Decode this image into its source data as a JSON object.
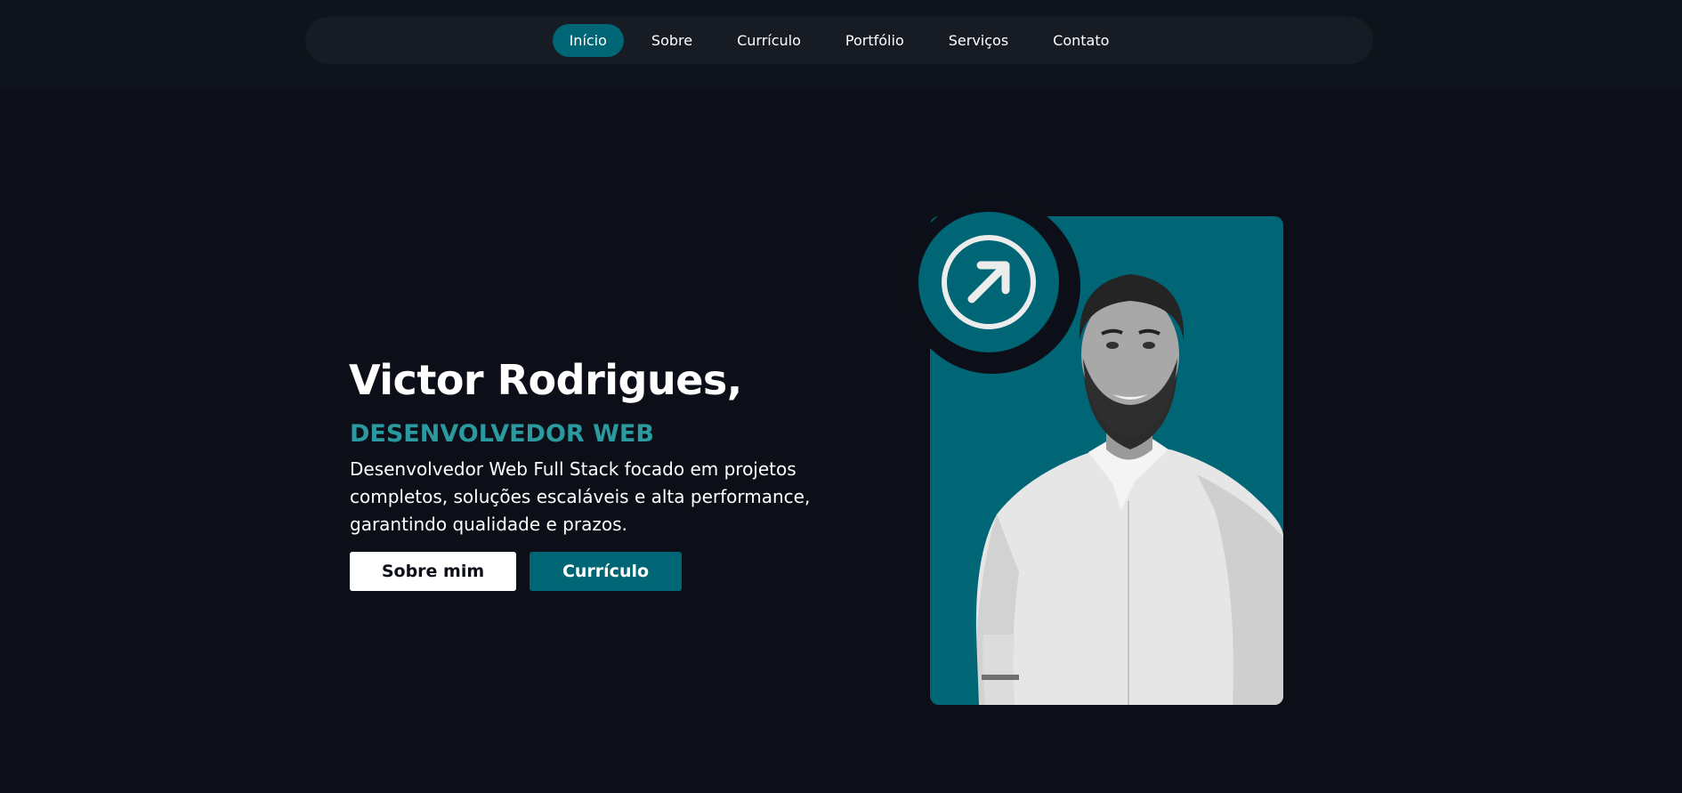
{
  "nav": {
    "items": [
      {
        "label": "Início",
        "active": true
      },
      {
        "label": "Sobre",
        "active": false
      },
      {
        "label": "Currículo",
        "active": false
      },
      {
        "label": "Portfólio",
        "active": false
      },
      {
        "label": "Serviços",
        "active": false
      },
      {
        "label": "Contato",
        "active": false
      }
    ]
  },
  "hero": {
    "name": "Victor Rodrigues,",
    "role": "DESENVOLVEDOR WEB",
    "description": "Desenvolvedor Web Full Stack focado em projetos completos, soluções escaláveis e alta performance, garantindo qualidade e prazos.",
    "buttons": {
      "about_label": "Sobre mim",
      "cv_label": "Currículo"
    }
  },
  "icons": {
    "badge": "arrow-up-right-circle-icon"
  },
  "colors": {
    "background": "#0c0f17",
    "nav_background": "#171c24",
    "accent": "#006575",
    "role_text": "#2b9aa0",
    "text": "#ffffff"
  }
}
